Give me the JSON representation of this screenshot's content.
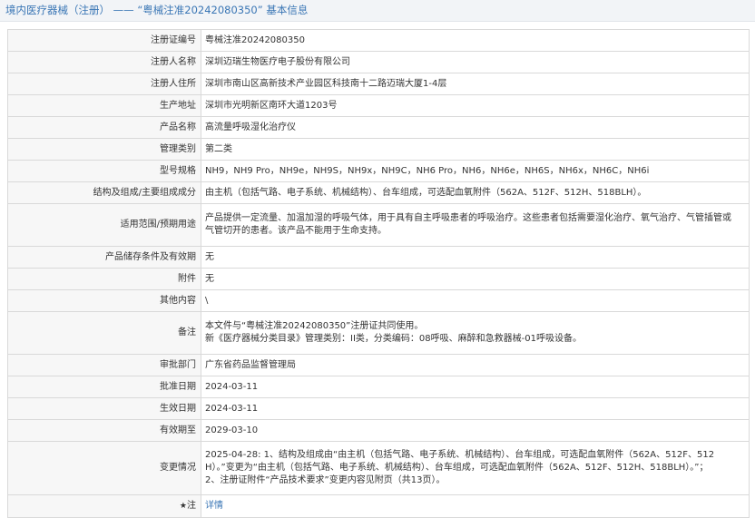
{
  "header": {
    "section": "境内医疗器械（注册）",
    "separator": "——",
    "record_quote": "“粤械注准20242080350”",
    "suffix": "基本信息"
  },
  "rows": [
    {
      "label": "注册证编号",
      "value": "粤械注准20242080350"
    },
    {
      "label": "注册人名称",
      "value": "深圳迈瑞生物医疗电子股份有限公司"
    },
    {
      "label": "注册人住所",
      "value": "深圳市南山区高新技术产业园区科技南十二路迈瑞大厦1-4层"
    },
    {
      "label": "生产地址",
      "value": "深圳市光明新区南环大道1203号"
    },
    {
      "label": "产品名称",
      "value": "高流量呼吸湿化治疗仪"
    },
    {
      "label": "管理类别",
      "value": "第二类"
    },
    {
      "label": "型号规格",
      "value": "NH9，NH9 Pro，NH9e，NH9S，NH9x，NH9C，NH6 Pro，NH6，NH6e，NH6S，NH6x，NH6C，NH6i"
    },
    {
      "label": "结构及组成/主要组成成分",
      "value": "由主机（包括气路、电子系统、机械结构）、台车组成，可选配血氧附件（562A、512F、512H、518BLH）。"
    },
    {
      "label": "适用范围/预期用途",
      "lines": [
        "产品提供一定流量、加温加湿的呼吸气体，用于具有自主呼吸患者的呼吸治疗。这些患者包括需要湿化治疗、氧气治疗、气管插管或",
        "气管切开的患者。该产品不能用于生命支持。"
      ]
    },
    {
      "label": "产品储存条件及有效期",
      "value": "无"
    },
    {
      "label": "附件",
      "value": "无"
    },
    {
      "label": "其他内容",
      "value": "\\"
    },
    {
      "label": "备注",
      "lines": [
        "本文件与“粤械注准20242080350”注册证共同使用。",
        "新《医疗器械分类目录》管理类别：II类，分类编码：08呼吸、麻醉和急救器械-01呼吸设备。"
      ]
    },
    {
      "label": "审批部门",
      "value": "广东省药品监督管理局"
    },
    {
      "label": "批准日期",
      "value": "2024-03-11"
    },
    {
      "label": "生效日期",
      "value": "2024-03-11"
    },
    {
      "label": "有效期至",
      "value": "2029-03-10"
    },
    {
      "label": "变更情况",
      "lines": [
        "2025-04-28: 1、结构及组成由“由主机（包括气路、电子系统、机械结构）、台车组成，可选配血氧附件（562A、512F、512",
        "H）。”变更为“由主机（包括气路、电子系统、机械结构）、台车组成，可选配血氧附件（562A、512F、512H、518BLH）。”；",
        "2、注册证附件“产品技术要求”变更内容见附页（共13页）。"
      ]
    },
    {
      "label": "注",
      "value": "详情"
    }
  ],
  "colors": {
    "accent": "#3a76b5",
    "label_bg": "#f7f7f7",
    "border": "#d9d9d9"
  },
  "icons": {
    "note": "star-icon"
  }
}
